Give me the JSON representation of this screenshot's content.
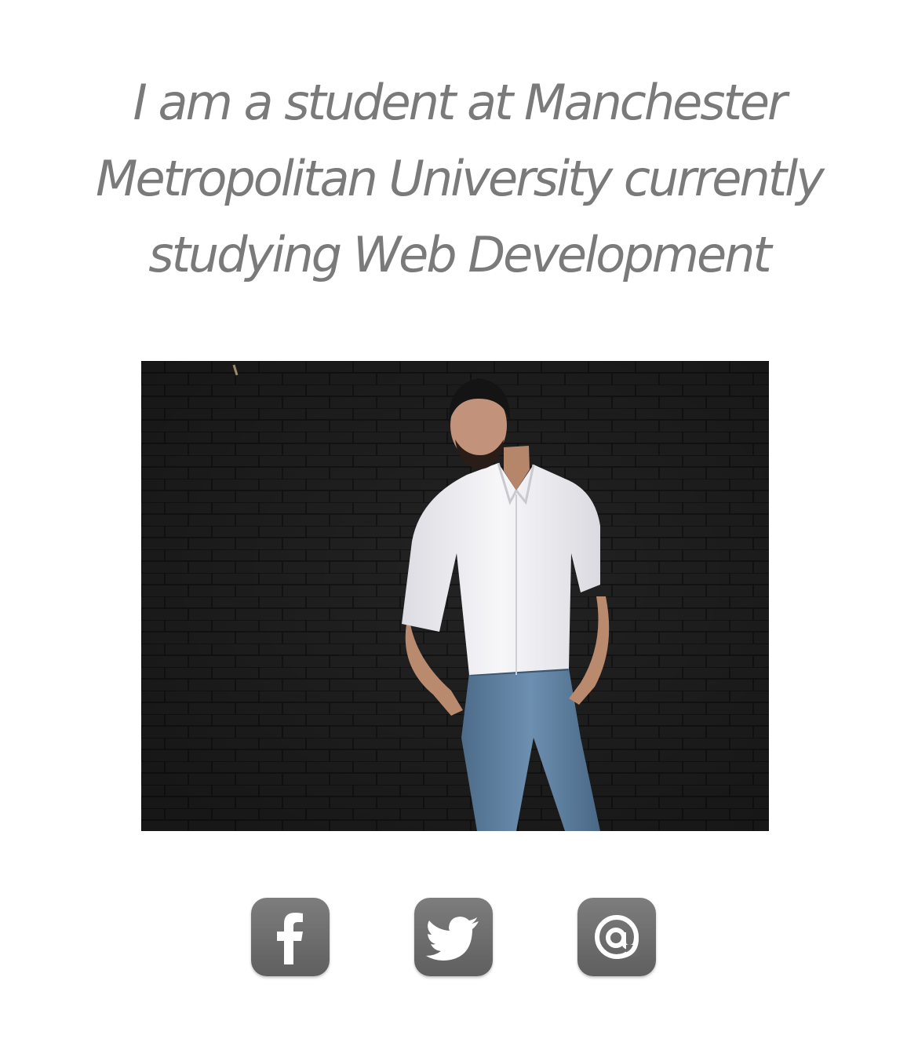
{
  "intro": {
    "text": "I am a student at Manchester Metropolitan University currently studying Web Development"
  },
  "profile_photo": {
    "alt": "Portrait of the student in a white shirt and blue jeans in front of a black brick wall"
  },
  "social_links": [
    {
      "name": "facebook",
      "icon": "facebook-icon",
      "label": "Facebook"
    },
    {
      "name": "twitter",
      "icon": "twitter-bird-icon",
      "label": "Twitter"
    },
    {
      "name": "email",
      "icon": "at-sign-icon",
      "label": "Email"
    }
  ],
  "colors": {
    "text": "#7a7a7a",
    "icon_bg": "#6e6e6e",
    "brick_wall": "#222222",
    "shirt": "#f2f2f4",
    "jeans": "#5a7d9e"
  }
}
